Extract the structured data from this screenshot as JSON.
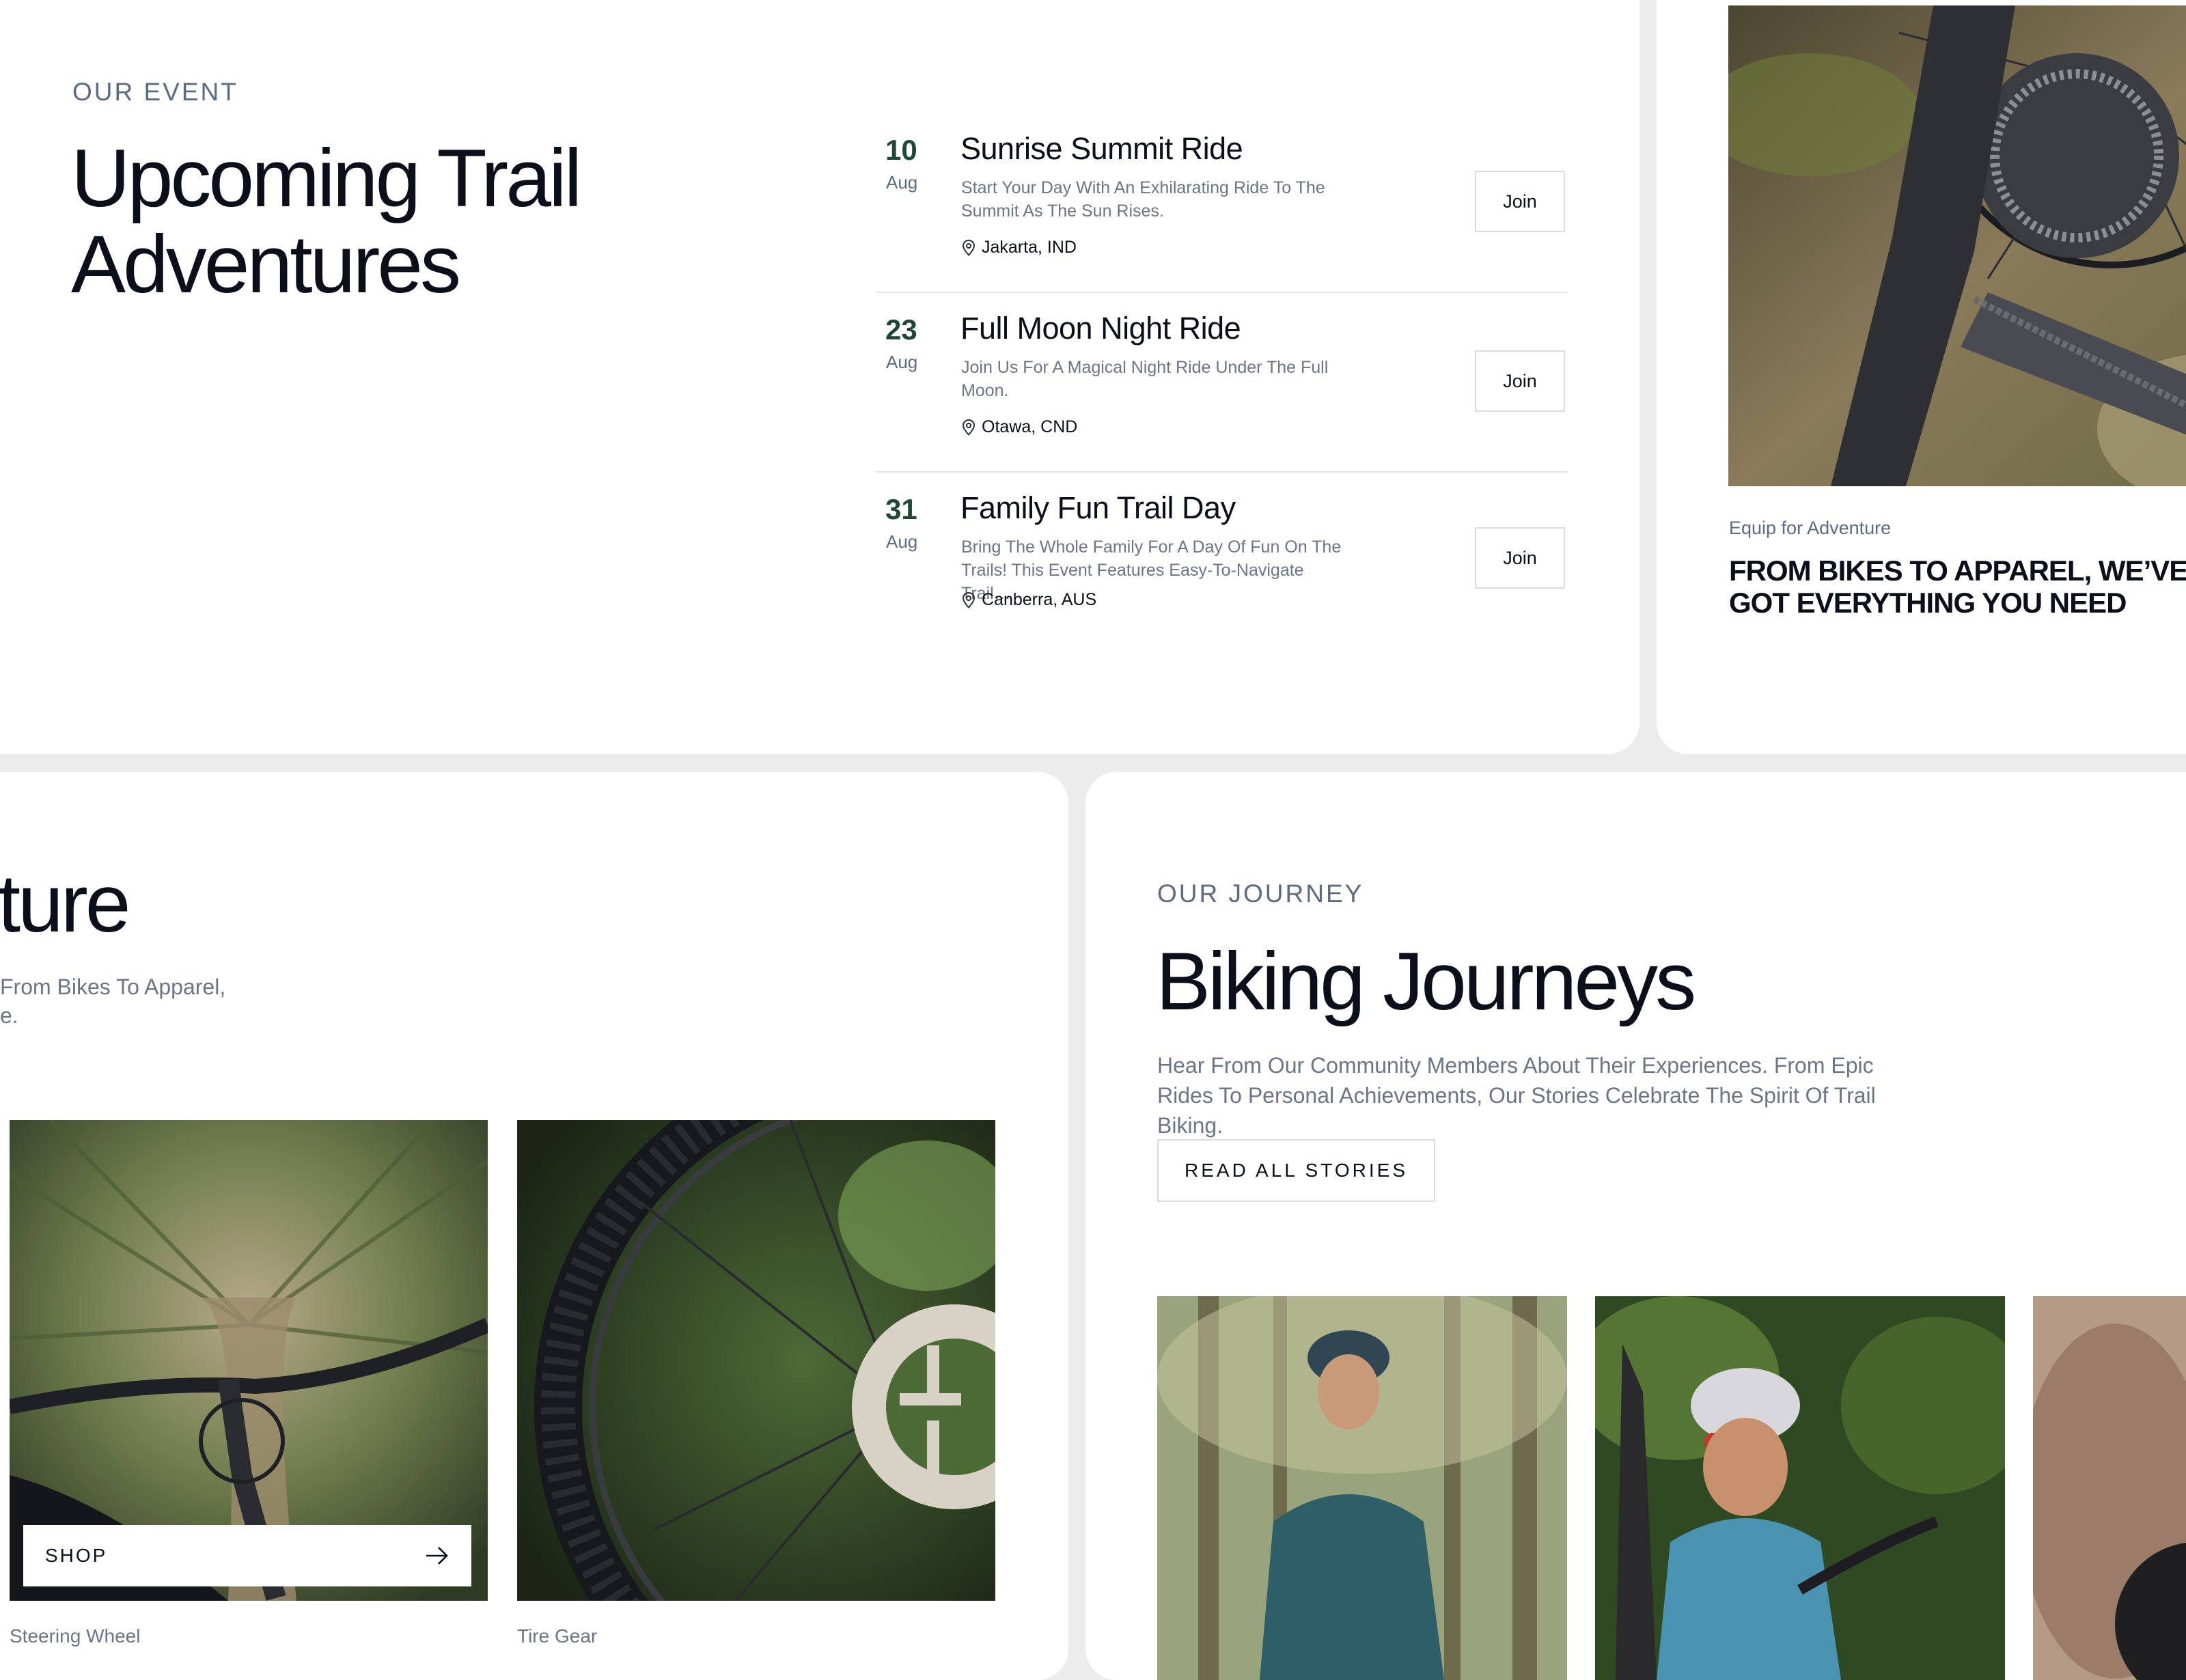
{
  "events": {
    "eyebrow": "OUR EVENT",
    "title_line1": "Upcoming Trail",
    "title_line2": "Adventures",
    "items": [
      {
        "day": "10",
        "month": "Aug",
        "title": "Sunrise Summit Ride",
        "desc": "Start Your Day With An Exhilarating Ride To The Summit As The Sun Rises.",
        "location": "Jakarta, IND",
        "button": "Join"
      },
      {
        "day": "23",
        "month": "Aug",
        "title": "Full Moon Night Ride",
        "desc": "Join Us For A Magical Night Ride Under The Full Moon.",
        "location": "Otawa, CND",
        "button": "Join"
      },
      {
        "day": "31",
        "month": "Aug",
        "title": "Family Fun Trail Day",
        "desc": "Bring The Whole Family For A Day Of Fun On The Trails! This Event Features Easy-To-Navigate Trail…",
        "location": "Canberra, AUS",
        "button": "Join"
      }
    ]
  },
  "equip": {
    "label": "Equip for Adventure",
    "headline": "FROM BIKES TO APPAREL, WE’VE GOT EVERYTHING YOU NEED"
  },
  "shop": {
    "title_partial": "nture",
    "sub_line1": "From Bikes To Apparel,",
    "sub_line2": "e.",
    "shop_button": "SHOP",
    "caption1": "Steering Wheel",
    "caption2": "Tire Gear"
  },
  "journey": {
    "eyebrow": "OUR JOURNEY",
    "title": "Biking Journeys",
    "desc": "Hear From Our Community Members About Their Experiences. From Epic Rides To Personal Achievements, Our Stories Celebrate The Spirit Of Trail Biking.",
    "button": "READ ALL STORIES"
  },
  "colors": {
    "accent_date": "#1e4734",
    "text_dark": "#0b0f19",
    "text_muted": "#6b7585",
    "background": "#ececec"
  },
  "icons": {
    "location": "location-pin-icon",
    "arrow": "arrow-right-icon"
  }
}
